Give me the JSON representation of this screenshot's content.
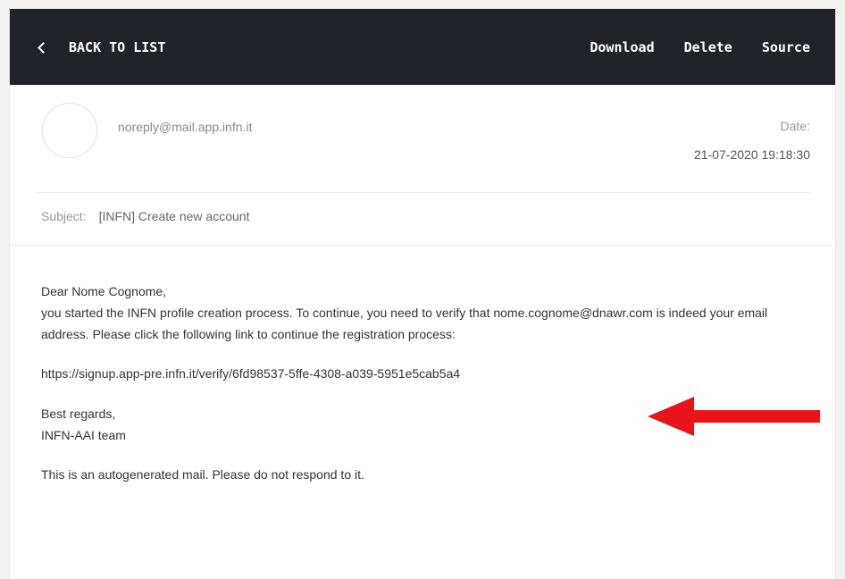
{
  "toolbar": {
    "back_label": "BACK TO LIST",
    "download_label": "Download",
    "delete_label": "Delete",
    "source_label": "Source"
  },
  "email": {
    "sender": "noreply@mail.app.infn.it",
    "date_label": "Date:",
    "date_value": "21-07-2020 19:18:30",
    "subject_label": "Subject:",
    "subject": "[INFN] Create new account",
    "greeting": "Dear Nome Cognome,",
    "paragraph": "you started the INFN profile creation process. To continue, you need to verify that nome.cognome@dnawr.com is indeed your email address. Please click the following link to continue the registration process:",
    "link": "https://signup.app-pre.infn.it/verify/6fd98537-5ffe-4308-a039-5951e5cab5a4",
    "regards": "Best regards,",
    "team": "INFN-AAI team",
    "footer_note": "This is an autogenerated mail. Please do not respond to it."
  },
  "colors": {
    "topbar": "#21232a",
    "arrow": "#e8141a"
  },
  "icons": {
    "back": "chevron-left-icon",
    "annotation": "red-arrow-icon"
  }
}
